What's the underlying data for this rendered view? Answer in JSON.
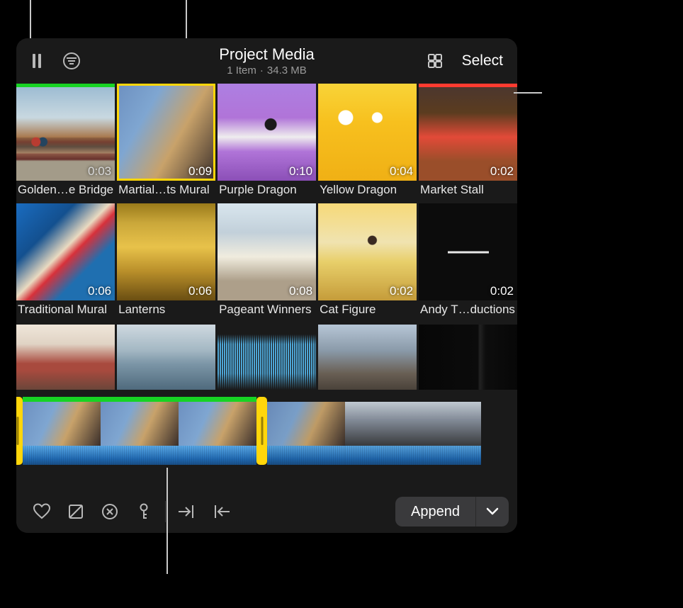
{
  "header": {
    "title": "Project Media",
    "items_label": "1 Item",
    "size_label": "34.3 MB",
    "select_label": "Select"
  },
  "clips": [
    {
      "name": "Golden…e Bridge",
      "duration": "0:03",
      "marker": "green",
      "selected": false,
      "bg": "bg-golden"
    },
    {
      "name": "Martial…ts Mural",
      "duration": "0:09",
      "marker": null,
      "selected": true,
      "bg": "bg-martial"
    },
    {
      "name": "Purple Dragon",
      "duration": "0:10",
      "marker": null,
      "selected": false,
      "bg": "bg-purple"
    },
    {
      "name": "Yellow Dragon",
      "duration": "0:04",
      "marker": null,
      "selected": false,
      "bg": "bg-yellow"
    },
    {
      "name": "Market Stall",
      "duration": "0:02",
      "marker": "red",
      "selected": false,
      "bg": "bg-market"
    },
    {
      "name": "Traditional Mural",
      "duration": "0:06",
      "marker": null,
      "selected": false,
      "bg": "bg-tradmural"
    },
    {
      "name": "Lanterns",
      "duration": "0:06",
      "marker": null,
      "selected": false,
      "bg": "bg-lanterns"
    },
    {
      "name": "Pageant Winners",
      "duration": "0:08",
      "marker": null,
      "selected": false,
      "bg": "bg-pageant"
    },
    {
      "name": "Cat Figure",
      "duration": "0:02",
      "marker": null,
      "selected": false,
      "bg": "bg-cat"
    },
    {
      "name": "Andy T…ductions",
      "duration": "0:02",
      "marker": null,
      "selected": false,
      "bg": "bg-andy"
    }
  ],
  "row3_bgs": [
    "bg-gg2",
    "bg-bay",
    "bg-wave",
    "bg-civic",
    "bg-dark"
  ],
  "filmstrip": {
    "selected_frames_bg": "mural",
    "rest_frames_bg": "street"
  },
  "toolbar": {
    "append_label": "Append"
  },
  "icons": {
    "pause": "pause-icon",
    "filter": "filter-icon",
    "layout": "layout-icon",
    "heart": "heart-icon",
    "reject": "reject-icon",
    "clear": "clear-rating-icon",
    "keyword": "keyword-icon",
    "mark_in": "mark-in-icon",
    "mark_out": "mark-out-icon",
    "chevron": "chevron-down-icon"
  }
}
